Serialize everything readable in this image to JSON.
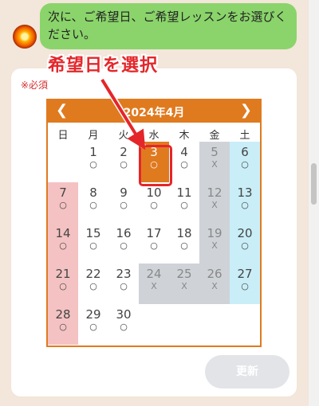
{
  "chat": {
    "message": "次に、ご希望日、ご希望レッスンをお選びください。",
    "avatar_icon": "sun-avatar-icon"
  },
  "form": {
    "required_label": "※必須",
    "update_label": "更新"
  },
  "annotation": {
    "text": "希望日を選択",
    "color": "#e4262a"
  },
  "calendar": {
    "title": "2024年4月",
    "prev_label": "❮",
    "next_label": "❯",
    "accent_color": "#e07a1f",
    "weekdays": [
      "日",
      "月",
      "火",
      "水",
      "木",
      "金",
      "土"
    ],
    "selected_day": "3",
    "weeks": [
      [
        null,
        {
          "day": "1",
          "mark": "○"
        },
        {
          "day": "2",
          "mark": "○"
        },
        {
          "day": "3",
          "mark": "○",
          "state": "selected"
        },
        {
          "day": "4",
          "mark": "○"
        },
        {
          "day": "5",
          "mark": "X",
          "state": "closed"
        },
        {
          "day": "6",
          "mark": "○"
        }
      ],
      [
        {
          "day": "7",
          "mark": "○"
        },
        {
          "day": "8",
          "mark": "○"
        },
        {
          "day": "9",
          "mark": "○"
        },
        {
          "day": "10",
          "mark": "○"
        },
        {
          "day": "11",
          "mark": "○"
        },
        {
          "day": "12",
          "mark": "X",
          "state": "closed"
        },
        {
          "day": "13",
          "mark": "○"
        }
      ],
      [
        {
          "day": "14",
          "mark": "○"
        },
        {
          "day": "15",
          "mark": "○"
        },
        {
          "day": "16",
          "mark": "○"
        },
        {
          "day": "17",
          "mark": "○"
        },
        {
          "day": "18",
          "mark": "○"
        },
        {
          "day": "19",
          "mark": "X",
          "state": "closed"
        },
        {
          "day": "20",
          "mark": "○"
        }
      ],
      [
        {
          "day": "21",
          "mark": "○"
        },
        {
          "day": "22",
          "mark": "○"
        },
        {
          "day": "23",
          "mark": "○"
        },
        {
          "day": "24",
          "mark": "X",
          "state": "closed"
        },
        {
          "day": "25",
          "mark": "X",
          "state": "closed"
        },
        {
          "day": "26",
          "mark": "X",
          "state": "closed"
        },
        {
          "day": "27",
          "mark": "○"
        }
      ],
      [
        {
          "day": "28",
          "mark": "○"
        },
        {
          "day": "29",
          "mark": "○"
        },
        {
          "day": "30",
          "mark": "○"
        },
        null,
        null,
        null,
        null
      ]
    ]
  }
}
